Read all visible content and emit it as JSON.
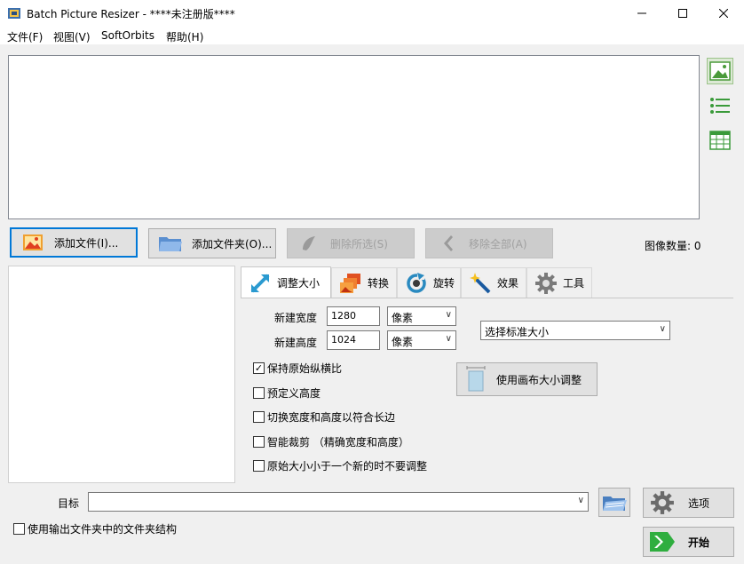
{
  "window": {
    "title": "Batch Picture Resizer - ****未注册版****",
    "minimize": "—",
    "maximize": "☐",
    "close": "✕"
  },
  "menu": [
    "文件(F)",
    "视图(V)",
    "SoftOrbits",
    "帮助(H)"
  ],
  "toolbar": {
    "add_files": "添加文件(I)...",
    "add_folder": "添加文件夹(O)...",
    "remove_selected": "删除所选(S)",
    "remove_all": "移除全部(A)",
    "image_count": "图像数量: 0"
  },
  "tabs": [
    "调整大小",
    "转换",
    "旋转",
    "效果",
    "工具"
  ],
  "resize": {
    "width_label": "新建宽度",
    "width_value": "1280",
    "width_unit": "像素",
    "height_label": "新建高度",
    "height_value": "1024",
    "height_unit": "像素",
    "standard_size": "选择标准大小",
    "canvas_button": "使用画布大小调整",
    "options": [
      {
        "label": "保持原始纵横比",
        "checked": true
      },
      {
        "label": "预定义高度",
        "checked": false
      },
      {
        "label": "切换宽度和高度以符合长边",
        "checked": false
      },
      {
        "label": "智能裁剪 （精确宽度和高度）",
        "checked": false
      },
      {
        "label": "原始大小小于一个新的时不要调整",
        "checked": false
      }
    ]
  },
  "bottom": {
    "target_label": "目标",
    "target_value": "",
    "options_button": "选项",
    "start_button": "开始",
    "keep_structure": "使用输出文件夹中的文件夹结构"
  },
  "colors": {
    "accent": "#0078d7",
    "start_green": "#2fae3f"
  }
}
